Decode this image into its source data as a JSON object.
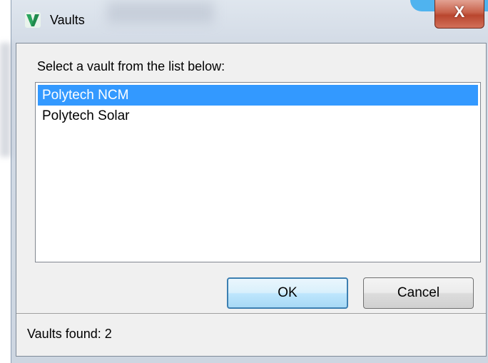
{
  "window": {
    "title": "Vaults",
    "close_label": "X",
    "icon": "v-logo-icon"
  },
  "dialog": {
    "prompt": "Select a vault from the list below:",
    "vaults": [
      {
        "label": "Polytech NCM",
        "selected": true
      },
      {
        "label": "Polytech Solar",
        "selected": false
      }
    ],
    "ok_label": "OK",
    "cancel_label": "Cancel"
  },
  "status": {
    "text": "Vaults found: 2"
  },
  "colors": {
    "selection": "#3399ff",
    "logo_green": "#1f8a4c",
    "close_red": "#c8614a"
  }
}
